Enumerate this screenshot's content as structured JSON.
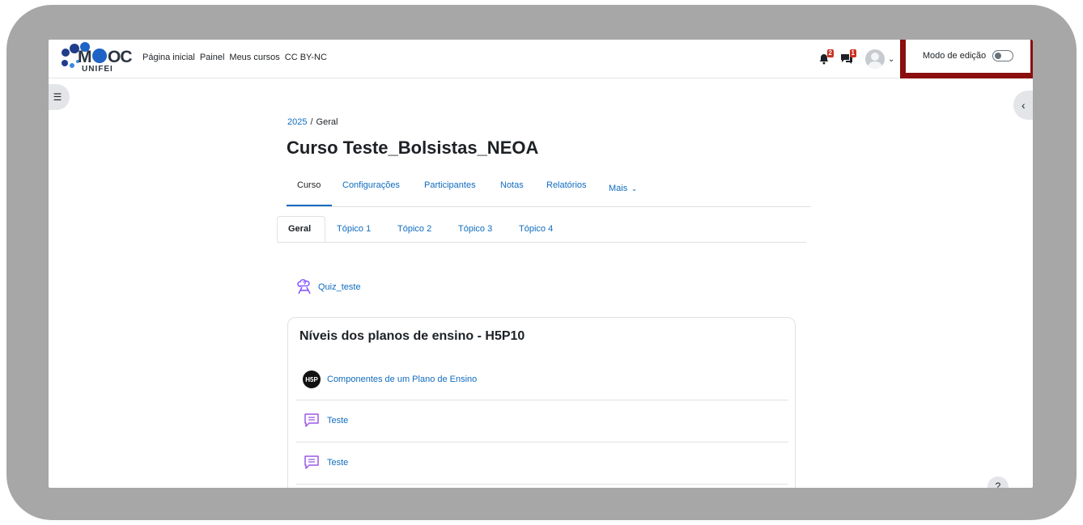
{
  "navbar": {
    "logo": {
      "main_m": "M",
      "main_oc": "OC",
      "sub": "UNIFEI"
    },
    "links": [
      "Página inicial",
      "Painel",
      "Meus cursos",
      "CC BY-NC"
    ],
    "notifications_count": "2",
    "messages_count": "1",
    "edit_mode_label": "Modo de edição"
  },
  "breadcrumb": {
    "year": "2025",
    "separator": "/",
    "category": "Geral"
  },
  "course": {
    "title": "Curso Teste_Bolsistas_NEOA"
  },
  "secondary_nav": [
    "Curso",
    "Configurações",
    "Participantes",
    "Notas",
    "Relatórios",
    "Mais"
  ],
  "topic_tabs": [
    "Geral",
    "Tópico 1",
    "Tópico 2",
    "Tópico 3",
    "Tópico 4"
  ],
  "top_activity": {
    "name": "Quiz_teste"
  },
  "section": {
    "title": "Níveis dos planos de ensino - H5P10",
    "h5p_badge": "H5P",
    "activities": [
      "Componentes de um Plano de Ensino",
      "Teste",
      "Teste"
    ]
  },
  "help": {
    "label": "?"
  },
  "colors": {
    "frame": "#a7a7a7",
    "highlight_border": "#8b0f0f",
    "link": "#0f6cbf",
    "quiz_icon": "#7c4dff",
    "forum_icon": "#9b59e6"
  }
}
